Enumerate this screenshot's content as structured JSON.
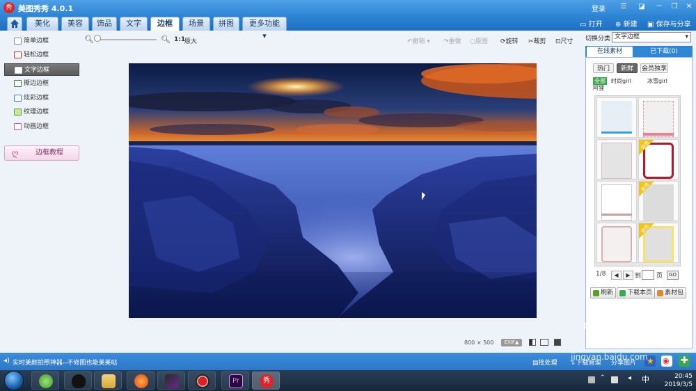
{
  "app": {
    "title": "美图秀秀 4.0.1",
    "logo_char": "秀",
    "login": "登录"
  },
  "window_controls": {
    "minimize": "－",
    "restore": "❐",
    "close": "✕"
  },
  "tabs": [
    {
      "label": ""
    },
    {
      "label": "美化"
    },
    {
      "label": "美容"
    },
    {
      "label": "饰品"
    },
    {
      "label": "文字"
    },
    {
      "label": "边框"
    },
    {
      "label": "场景"
    },
    {
      "label": "拼图"
    },
    {
      "label": "更多功能"
    }
  ],
  "top_actions": {
    "open": "打开",
    "new": "新建",
    "save": "保存与分享"
  },
  "toolbar": {
    "ratio": "1:1",
    "original": "原大",
    "undo": "撤销",
    "redo": "重做",
    "restore": "原图",
    "rotate": "旋转",
    "crop": "裁剪",
    "resize": "尺寸"
  },
  "left_menu": {
    "items": [
      {
        "label": "简单边框"
      },
      {
        "label": "轻松边框"
      },
      {
        "label": "文字边框"
      },
      {
        "label": "撕边边框"
      },
      {
        "label": "炫彩边框"
      },
      {
        "label": "纹理边框"
      },
      {
        "label": "动画边框"
      }
    ],
    "tutorial": "边框教程"
  },
  "image_info": {
    "width": "800",
    "times": "×",
    "height": "500",
    "exif": "EXIF▲"
  },
  "right_panel": {
    "category_label": "切换分类",
    "category_value": "文字边框",
    "tabs": {
      "online": "在线素材",
      "downloaded": "已下载(0)"
    },
    "chips": [
      "热门",
      "新鲜",
      "会员独享"
    ],
    "subfilters": [
      "全部",
      "时尚girl",
      "冰雪girl",
      "阿狸"
    ],
    "badge_text": "会员",
    "pager": {
      "page": "1/8",
      "to": "到",
      "unit": "页",
      "go": "GO"
    },
    "actions": {
      "refresh": "刷新",
      "download_page": "下载本页",
      "pack": "素材包"
    }
  },
  "status": {
    "message": "实时美颜拍照神器--不修图也能美美哒",
    "batch": "批处理",
    "download_mgr": "下载管理",
    "share": "分享图片"
  },
  "taskbar": {
    "time": "20:45",
    "date": "2019/3/5"
  },
  "watermark": {
    "line1": "经验",
    "line2": "jingyan.baidu.com"
  },
  "colors": {
    "accent": "#2f86d6",
    "selected_item": "#5a5a5a",
    "brand_red": "#d9262c",
    "member_yellow": "#f0c419"
  }
}
